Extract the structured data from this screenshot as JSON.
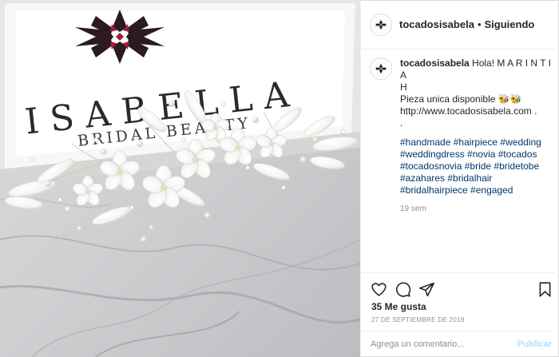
{
  "post": {
    "image": {
      "brand_name": "ISABELLA",
      "brand_subtitle": "BRIDAL BEAUTY",
      "subject": "white flower bridal hairpiece on marble"
    },
    "header": {
      "username": "tocadosisabela",
      "separator": "•",
      "follow_status": "Siguiendo"
    },
    "caption": {
      "username": "tocadosisabela",
      "greeting": "Hola! M A R I N T I A",
      "greeting_cont": "H",
      "line2": "Pieza unica disponible",
      "emoji": "🐝🐝",
      "url": "http://www.tocadosisabela.com .",
      "dot": ".",
      "hashtags": "#handmade #hairpiece #wedding #weddingdress #novia #tocados #tocadosnovia #bride #bridetobe #azahares #bridalhair #bridalhairpiece #engaged",
      "time": "19 sem"
    },
    "actions": {
      "like": "heart-icon",
      "comment": "comment-icon",
      "share": "paper-plane-icon",
      "save": "bookmark-icon"
    },
    "likes_text": "35 Me gusta",
    "date_text": "27 DE SEPTIEMBRE DE 2019",
    "comment": {
      "placeholder": "Agrega un comentario...",
      "publish_label": "Publicar"
    }
  },
  "colors": {
    "text": "#262626",
    "hashtag": "#00376b",
    "muted": "#8e8e8e",
    "publish_disabled": "#b2dffc",
    "logo_dark": "#2b1a1f",
    "logo_accent": "#9e1f3b"
  }
}
